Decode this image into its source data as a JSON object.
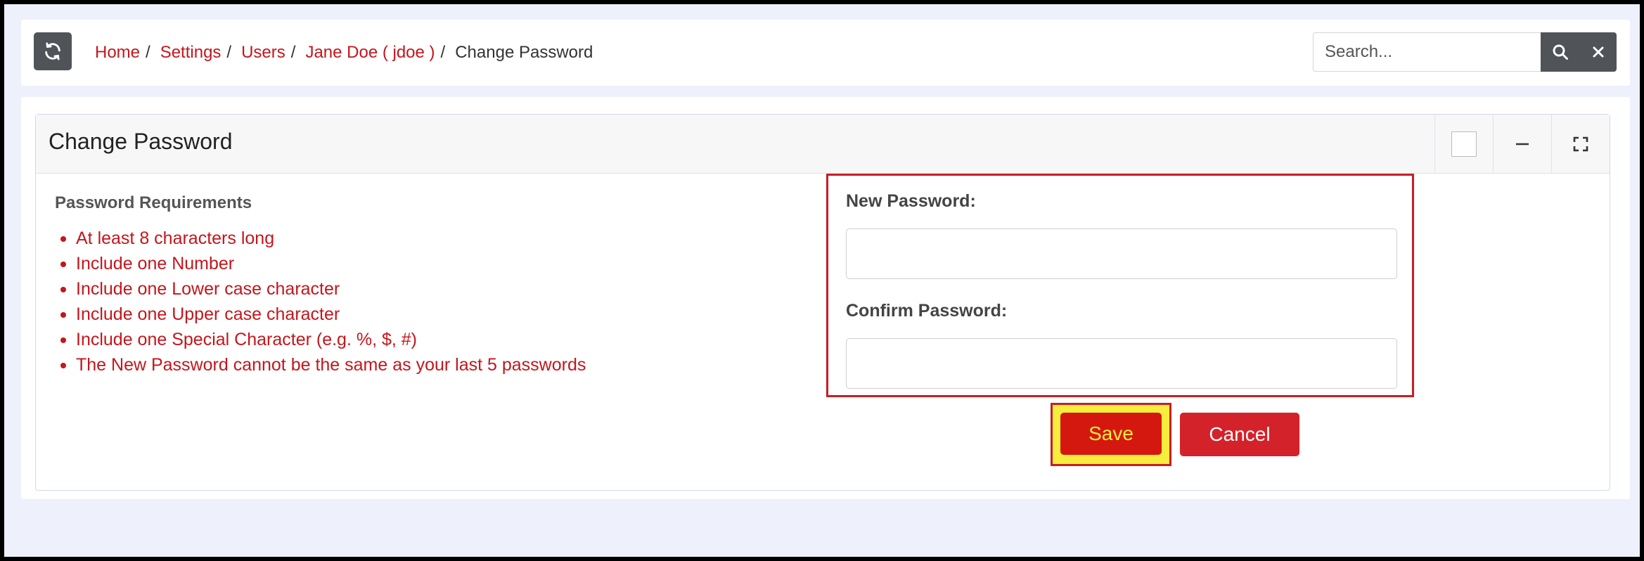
{
  "topbar": {
    "refresh_icon": "refresh-icon",
    "breadcrumb": {
      "home": "Home",
      "settings": "Settings",
      "users": "Users",
      "user": "Jane Doe ( jdoe )",
      "current": "Change Password",
      "separator": "/"
    },
    "search": {
      "placeholder": "Search...",
      "value": "",
      "search_icon": "search-icon",
      "clear_icon": "close-icon"
    }
  },
  "card": {
    "title": "Change Password",
    "tools": [
      "checkbox",
      "minimize-icon",
      "expand-icon"
    ],
    "requirements": {
      "title": "Password Requirements",
      "items": [
        "At least 8 characters long",
        "Include one Number",
        "Include one Lower case character",
        "Include one Upper case character",
        "Include one Special Character (e.g. %, $, #)",
        "The New Password cannot be the same as your last 5 passwords"
      ]
    },
    "form": {
      "new_password_label": "New Password:",
      "new_password_value": "",
      "confirm_password_label": "Confirm Password:",
      "confirm_password_value": ""
    },
    "actions": {
      "save_label": "Save",
      "cancel_label": "Cancel"
    }
  },
  "colors": {
    "accent_red": "#c4161c",
    "dark_button": "#505357",
    "save_highlight": "#f6ed3c",
    "background": "#eef1fb"
  }
}
